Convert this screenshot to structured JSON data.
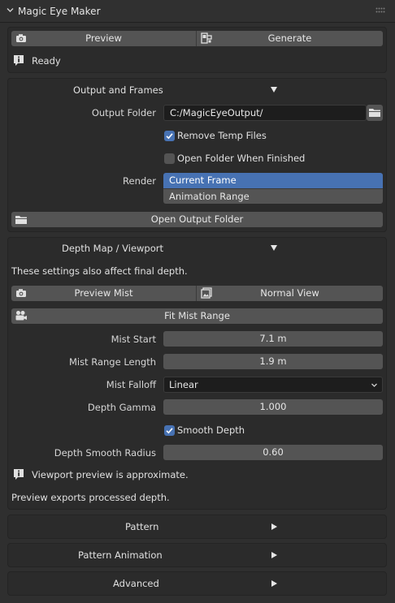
{
  "header": {
    "title": "Magic Eye Maker"
  },
  "top": {
    "preview_label": "Preview",
    "generate_label": "Generate",
    "status": "Ready"
  },
  "output": {
    "section_title": "Output and Frames",
    "folder_label": "Output Folder",
    "folder_value": "C:/MagicEyeOutput/",
    "remove_temp_label": "Remove Temp Files",
    "remove_temp_checked": true,
    "open_folder_label": "Open Folder When Finished",
    "open_folder_checked": false,
    "render_label": "Render",
    "render_options": [
      "Current Frame",
      "Animation Range"
    ],
    "render_selected": "Current Frame",
    "open_output_label": "Open Output Folder"
  },
  "depth": {
    "section_title": "Depth Map / Viewport",
    "note": "These settings also affect final depth.",
    "preview_mist_label": "Preview Mist",
    "normal_view_label": "Normal View",
    "fit_mist_label": "Fit Mist Range",
    "mist_start_label": "Mist Start",
    "mist_start_value": "7.1 m",
    "mist_range_label": "Mist Range Length",
    "mist_range_value": "1.9 m",
    "mist_falloff_label": "Mist Falloff",
    "mist_falloff_value": "Linear",
    "depth_gamma_label": "Depth Gamma",
    "depth_gamma_value": "1.000",
    "smooth_depth_label": "Smooth Depth",
    "smooth_depth_checked": true,
    "smooth_radius_label": "Depth Smooth Radius",
    "smooth_radius_value": "0.60",
    "info_text": "Viewport preview is approximate.",
    "export_note": "Preview exports processed depth."
  },
  "collapsed_sections": {
    "pattern": "Pattern",
    "pattern_animation": "Pattern Animation",
    "advanced": "Advanced"
  },
  "colors": {
    "accent": "#4772b3",
    "button": "#545454",
    "panel": "#2b2b2b",
    "background": "#2f2f2f"
  }
}
